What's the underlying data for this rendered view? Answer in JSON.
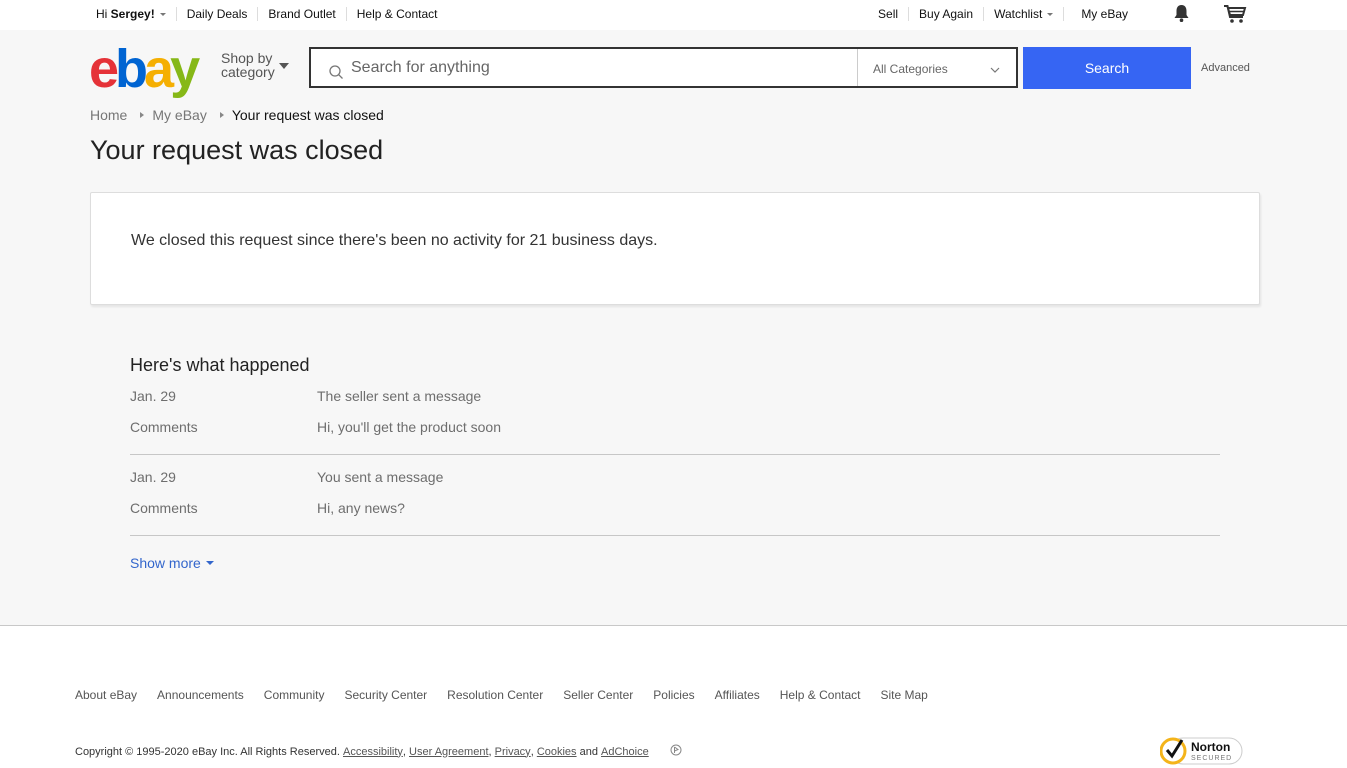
{
  "topbar": {
    "greeting_prefix": "Hi ",
    "user_name": "Sergey!",
    "left_links": [
      "Daily Deals",
      "Brand Outlet",
      "Help & Contact"
    ],
    "sell": "Sell",
    "buy_again": "Buy Again",
    "watchlist": "Watchlist",
    "my_ebay": "My eBay",
    "notification_icon": "bell-icon",
    "cart_icon": "cart-icon"
  },
  "header": {
    "logo": {
      "e": "e",
      "b": "b",
      "a": "a",
      "y": "y"
    },
    "logo_colors": {
      "e": "#e53238",
      "b": "#0064d2",
      "a": "#f5af02",
      "y": "#86b817"
    },
    "shop_by_line1": "Shop by",
    "shop_by_line2": "category",
    "search_placeholder": "Search for anything",
    "search_value": "",
    "category_selected": "All Categories",
    "search_button": "Search",
    "search_button_color": "#3665f3",
    "advanced_link": "Advanced"
  },
  "breadcrumb": {
    "items": [
      "Home",
      "My eBay",
      "Your request was closed"
    ]
  },
  "page": {
    "title": "Your request was closed",
    "status_message": "We closed this request since there's been no activity for 21 business days."
  },
  "history": {
    "heading": "Here's what happened",
    "events": [
      {
        "date": "Jan. 29",
        "action": "The seller sent a message",
        "comments_label": "Comments",
        "comments": "Hi, you'll get the product soon"
      },
      {
        "date": "Jan. 29",
        "action": "You sent a message",
        "comments_label": "Comments",
        "comments": "Hi, any news?"
      }
    ],
    "show_more": "Show more",
    "link_color": "#3366cc"
  },
  "footer": {
    "links": [
      "About eBay",
      "Announcements",
      "Community",
      "Security Center",
      "Resolution Center",
      "Seller Center",
      "Policies",
      "Affiliates",
      "Help & Contact",
      "Site Map"
    ],
    "copyright": "Copyright © 1995-2020 eBay Inc. All Rights Reserved. ",
    "legal_links": [
      "Accessibility",
      "User Agreement",
      "Privacy",
      "Cookies",
      "AdChoice"
    ],
    "and_text": " and ",
    "badge_title": "Norton",
    "badge_subtitle": "SECURED"
  }
}
